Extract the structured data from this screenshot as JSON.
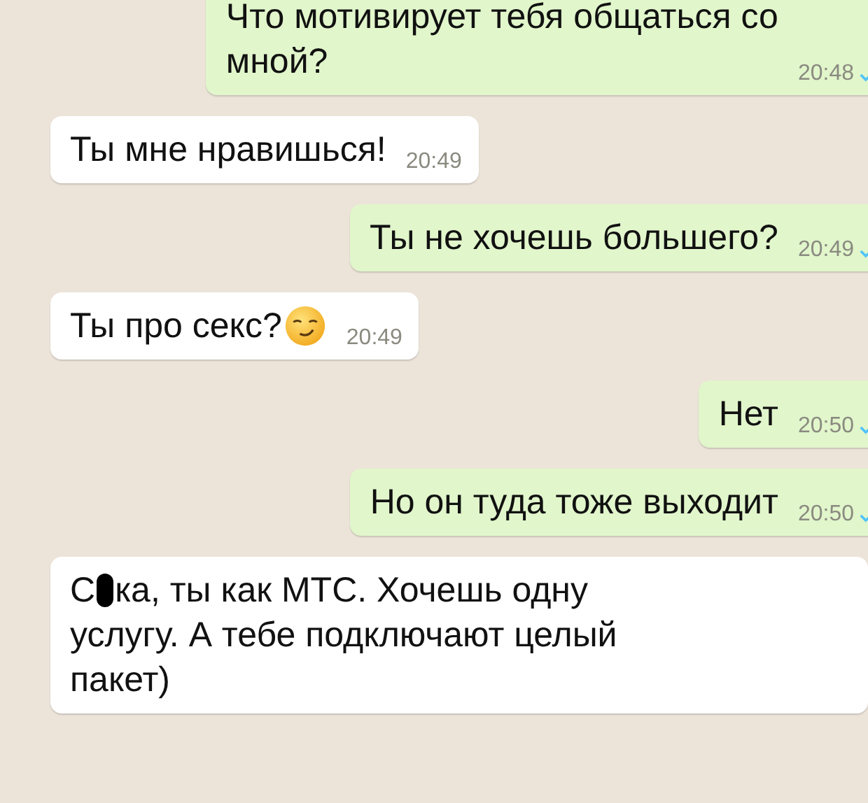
{
  "messages": [
    {
      "kind": "outgoing",
      "lines": [
        "Что мотивирует тебя общаться со",
        "мной?"
      ],
      "time": "20:48",
      "read": true
    },
    {
      "kind": "incoming",
      "lines": [
        "Ты мне нравишься!"
      ],
      "time": "20:49"
    },
    {
      "kind": "outgoing",
      "lines": [
        "Ты не хочешь большего?"
      ],
      "time": "20:49",
      "read": true
    },
    {
      "kind": "incoming",
      "lines": [
        "Ты про секс?"
      ],
      "emoji": true,
      "time": "20:49"
    },
    {
      "kind": "outgoing",
      "lines": [
        "Нет"
      ],
      "time": "20:50",
      "read": true
    },
    {
      "kind": "outgoing",
      "lines": [
        "Но он туда тоже выходит"
      ],
      "time": "20:50",
      "read": true
    },
    {
      "kind": "incoming",
      "censored": {
        "before": "С",
        "after": "ка, ты как МТС. Хочешь одну"
      },
      "lines": [
        "услугу. А тебе подключают целый",
        "пакет)"
      ]
    }
  ]
}
